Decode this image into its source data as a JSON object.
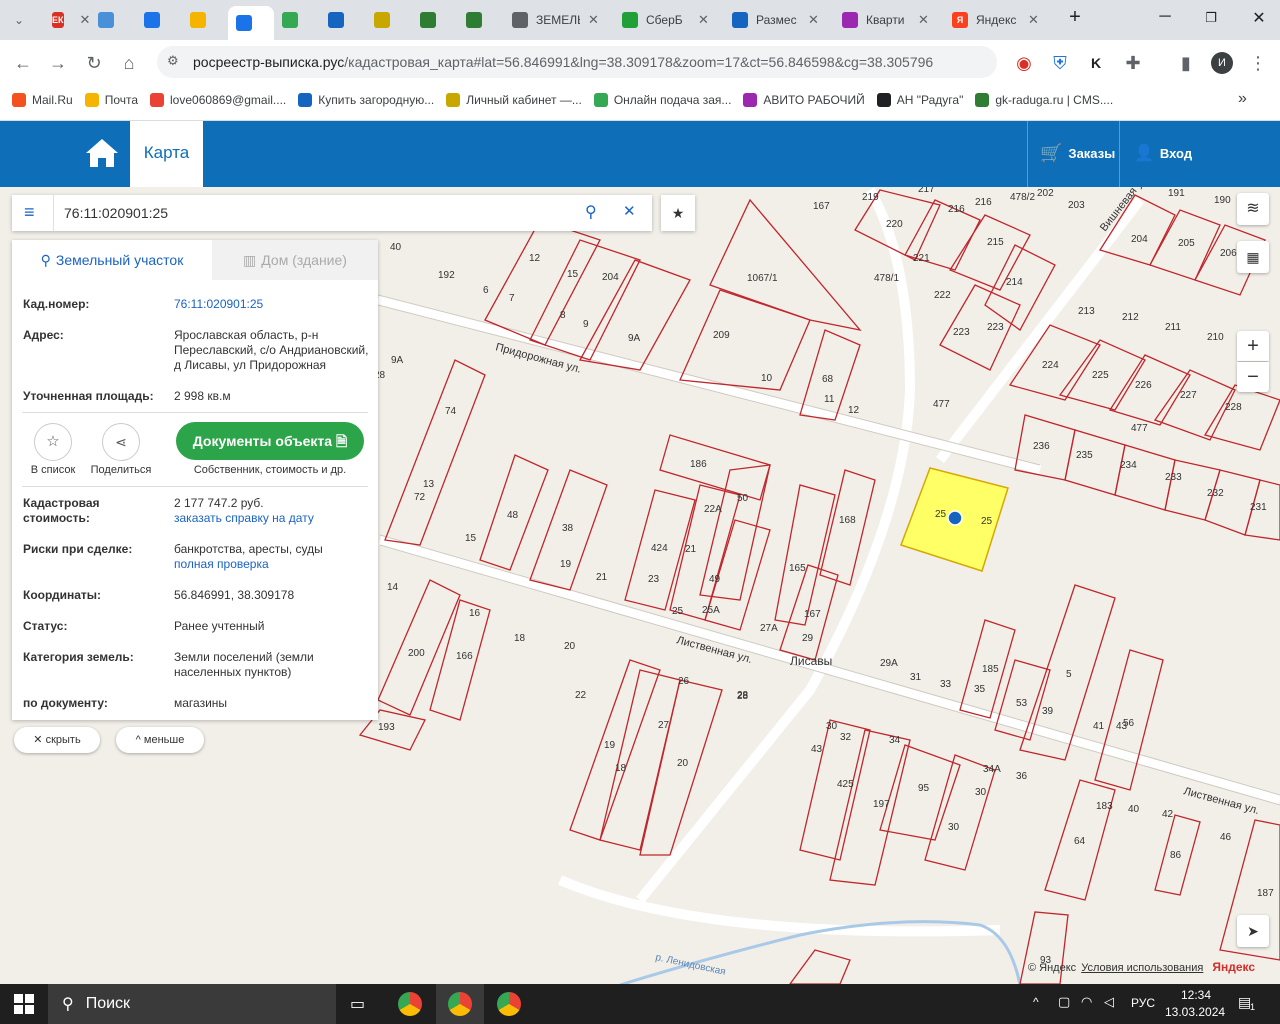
{
  "browser": {
    "tabs": [
      {
        "label": "ЕК",
        "favicon_color": "#d93025",
        "favicon_text": "ЕК"
      },
      {
        "label": "",
        "favicon_color": "#4a90d9",
        "favicon_text": ""
      },
      {
        "label": "",
        "favicon_color": "#1a73e8",
        "favicon_text": ""
      },
      {
        "label": "",
        "favicon_color": "#f4b400",
        "favicon_text": ""
      },
      {
        "label": "",
        "favicon_color": "#1a73e8",
        "favicon_text": "",
        "active": true
      },
      {
        "label": "",
        "favicon_color": "#34a853",
        "favicon_text": ""
      },
      {
        "label": "",
        "favicon_color": "#1565c0",
        "favicon_text": ""
      },
      {
        "label": "",
        "favicon_color": "#c8a800",
        "favicon_text": ""
      },
      {
        "label": "",
        "favicon_color": "#2e7d32",
        "favicon_text": ""
      },
      {
        "label": "",
        "favicon_color": "#2e7d32",
        "favicon_text": ""
      },
      {
        "label": "ЗЕМЕЛЬ",
        "favicon_color": "#5f6368",
        "favicon_text": ""
      },
      {
        "label": "СберБ",
        "favicon_color": "#21a038",
        "favicon_text": ""
      },
      {
        "label": "Размес",
        "favicon_color": "#1565c0",
        "favicon_text": ""
      },
      {
        "label": "Кварти",
        "favicon_color": "#9c27b0",
        "favicon_text": ""
      },
      {
        "label": "Яндекс",
        "favicon_color": "#fc3f1d",
        "favicon_text": "Я"
      }
    ],
    "new_tab": "+",
    "url_host": "росреестр-выписка.рус",
    "url_path": "/кадастровая_карта#lat=56.846991&lng=38.309178&zoom=17&ct=56.846598&cg=38.305796",
    "bookmarks": [
      {
        "label": "Mail.Ru",
        "color": "#f4511e"
      },
      {
        "label": "Почта",
        "color": "#f4b400"
      },
      {
        "label": "love060869@gmail....",
        "color": "#ea4335"
      },
      {
        "label": "Купить загородную...",
        "color": "#1565c0"
      },
      {
        "label": "Личный кабинет —...",
        "color": "#c8a800"
      },
      {
        "label": "Онлайн подача зая...",
        "color": "#34a853"
      },
      {
        "label": "АВИТО РАБОЧИЙ",
        "color": "#9c27b0"
      },
      {
        "label": "АН \"Радуга\"",
        "color": "#202124"
      },
      {
        "label": "gk-raduga.ru | CMS....",
        "color": "#2e7d32"
      }
    ],
    "bookmarks_more": "»",
    "profile_initial": "И"
  },
  "site": {
    "nav_map": "Карта",
    "orders": "Заказы",
    "login": "Вход"
  },
  "search": {
    "value": "76:11:020901:25"
  },
  "panel": {
    "tab_land": "Земельный участок",
    "tab_house": "Дом (здание)",
    "cad_label": "Кад.номер:",
    "cad_value": "76:11:020901:25",
    "addr_label": "Адрес:",
    "addr_value": "Ярославская область, р-н Переславский, с/о Андриановский, д Лисавы, ул Придорожная",
    "area_label": "Уточненная площадь:",
    "area_value": "2 998 кв.м",
    "btn_list": "В список",
    "btn_share": "Поделиться",
    "btn_docs": "Документы объекта",
    "docs_sub": "Собственник, стоимость и др.",
    "cost_label": "Кадастровая стоимость:",
    "cost_value": "2 177 747.2 руб.",
    "cost_link": "заказать справку на дату",
    "risk_label": "Риски при сделке:",
    "risk_value": "банкротства, аресты, суды",
    "risk_link": "полная проверка",
    "coord_label": "Координаты:",
    "coord_value": "56.846991, 38.309178",
    "status_label": "Статус:",
    "status_value": "Ранее учтенный",
    "cat_label": "Категория земель:",
    "cat_value": "Земли поселений (земли населенных пунктов)",
    "doc_label": "по документу:",
    "doc_value": "магазины"
  },
  "under_panel": {
    "hide": "скрыть",
    "less": "меньше"
  },
  "map": {
    "street_1": "Придорожная ул.",
    "street_2": "Лиственная ул.",
    "street_3": "Лиственная ул.",
    "street_4": "Вишневая ул.",
    "village": "Лисавы",
    "river": "р. Ленидовская",
    "zoom_in": "+",
    "zoom_out": "−",
    "copyright": "© Яндекс",
    "terms": "Условия использования",
    "yandex": "Яндекс",
    "parcel_labels": [
      "167",
      "219",
      "217",
      "216",
      "216",
      "478/2",
      "202",
      "203",
      "191",
      "190",
      "220",
      "221",
      "204",
      "205",
      "206",
      "1067/1",
      "478/1",
      "215",
      "222",
      "214",
      "209",
      "223",
      "223",
      "213",
      "212",
      "211",
      "210",
      "224",
      "225",
      "226",
      "227",
      "228",
      "68",
      "10",
      "11",
      "12",
      "477",
      "477",
      "236",
      "235",
      "234",
      "233",
      "232",
      "231",
      "186",
      "50",
      "13",
      "74",
      "72",
      "12",
      "6",
      "7",
      "8",
      "9",
      "9А",
      "15",
      "204",
      "192",
      "40",
      "28",
      "9А",
      "48",
      "38",
      "15",
      "19",
      "21",
      "23",
      "424",
      "21",
      "22А",
      "49",
      "25",
      "25А",
      "165",
      "168",
      "27А",
      "167",
      "29",
      "29А",
      "31",
      "33",
      "185",
      "35",
      "53",
      "39",
      "5",
      "41",
      "43",
      "56",
      "14",
      "16",
      "18",
      "20",
      "200",
      "166",
      "193",
      "22",
      "19",
      "18",
      "27",
      "28",
      "20",
      "26",
      "28",
      "30",
      "43",
      "32",
      "34",
      "425",
      "197",
      "95",
      "30",
      "30",
      "34А",
      "36",
      "183",
      "64",
      "40",
      "42",
      "86",
      "46",
      "187",
      "93",
      "25",
      "25"
    ],
    "highlight": "#ffff66"
  },
  "taskbar": {
    "search": "Поиск",
    "lang": "РУС",
    "time": "12:34",
    "date": "13.03.2024",
    "notif": "1"
  }
}
